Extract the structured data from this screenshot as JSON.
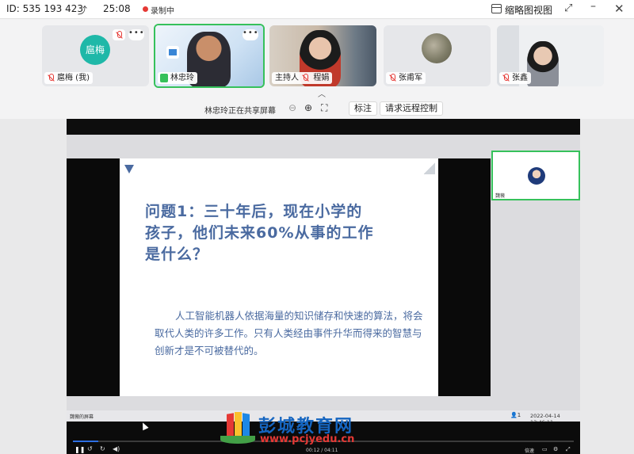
{
  "topbar": {
    "meeting_id": "ID: 535 193 423",
    "timer": "25:08",
    "recording_label": "录制中",
    "view_label": "缩略图视图"
  },
  "participants": [
    {
      "name": "扈梅 (我)",
      "avatar_text": "扈梅",
      "muted": true
    },
    {
      "name": "林忠玲",
      "active": true
    },
    {
      "role": "主持人",
      "name": "程娟",
      "muted": true
    },
    {
      "name": "张甫军",
      "muted": true
    },
    {
      "name": "张鑫",
      "muted": true
    }
  ],
  "sharebar": {
    "status": "林忠玲正在共享屏幕",
    "annotate_button": "标注",
    "remote_control_button": "请求远程控制"
  },
  "slide": {
    "title": "问题1：三十年后，现在小学的孩子，他们未来60%从事的工作是什么？",
    "body": "人工智能机器人依据海量的知识储存和快速的算法，将会取代人类的许多工作。只有人类经由事件升华而得来的智慧与创新才是不可被替代的。"
  },
  "shared_view": {
    "side_participant": "魏薇",
    "screen_owner": "魏薇的屏幕",
    "people_count": "1",
    "timestamp": "2022-04-14 13:46:11"
  },
  "player": {
    "time": "00:12 / 04:11",
    "progress": 0.05,
    "quality_label": "倍速"
  },
  "watermark": {
    "name": "彭城教育网",
    "url": "www.pcjyedu.cn"
  },
  "colors": {
    "accent_green": "#36c15b",
    "slide_text": "#4a6aa0",
    "record_red": "#e53935"
  }
}
